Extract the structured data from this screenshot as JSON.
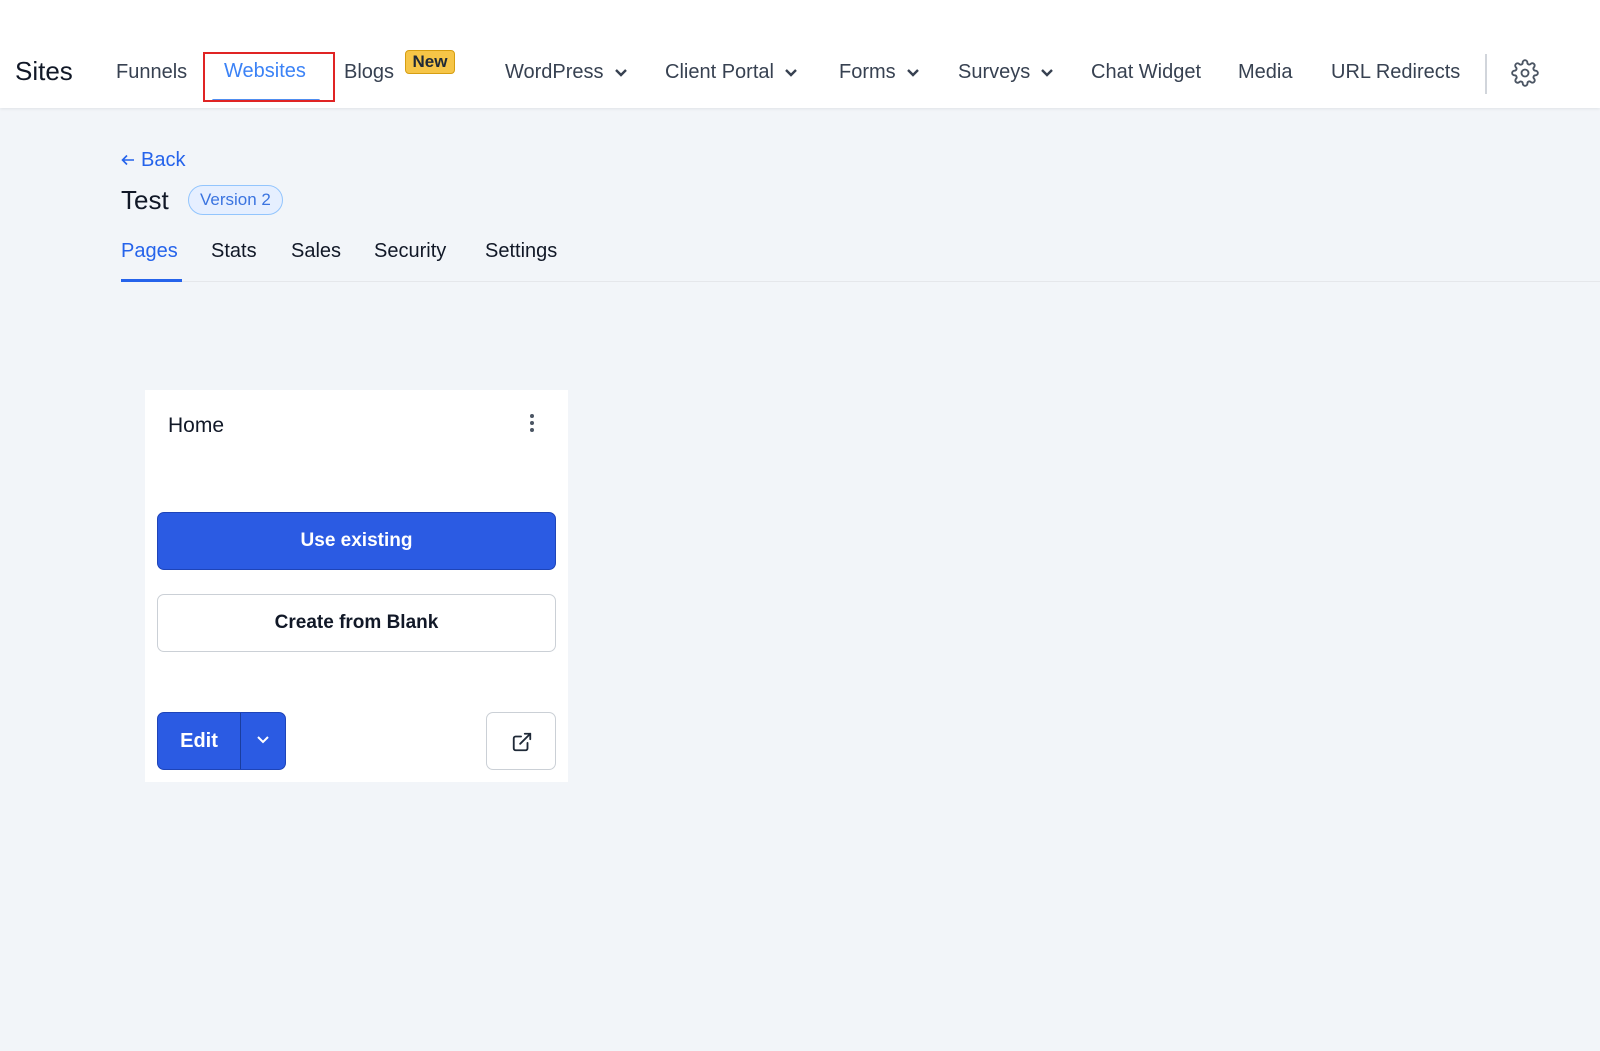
{
  "header": {
    "app_title": "Sites",
    "nav": [
      {
        "label": "Funnels"
      },
      {
        "label": "Websites",
        "active": true
      },
      {
        "label": "Blogs",
        "badge": "New"
      },
      {
        "label": "WordPress",
        "dropdown": true
      },
      {
        "label": "Client Portal",
        "dropdown": true
      },
      {
        "label": "Forms",
        "dropdown": true
      },
      {
        "label": "Surveys",
        "dropdown": true
      },
      {
        "label": "Chat Widget"
      },
      {
        "label": "Media"
      },
      {
        "label": "URL Redirects"
      }
    ],
    "settings_icon": "gear-icon"
  },
  "page": {
    "back_label": "Back",
    "title": "Test",
    "version_badge": "Version 2",
    "tabs": [
      {
        "label": "Pages",
        "active": true
      },
      {
        "label": "Stats"
      },
      {
        "label": "Sales"
      },
      {
        "label": "Security"
      },
      {
        "label": "Settings"
      }
    ]
  },
  "card": {
    "title": "Home",
    "use_existing_label": "Use existing",
    "create_blank_label": "Create from Blank",
    "edit_label": "Edit",
    "menu_icon": "kebab-menu-icon",
    "external_icon": "external-link-icon"
  },
  "colors": {
    "primary": "#2b5be3",
    "active_nav": "#3b82f6",
    "badge_new": "#f6c547",
    "highlight": "#e02424"
  }
}
